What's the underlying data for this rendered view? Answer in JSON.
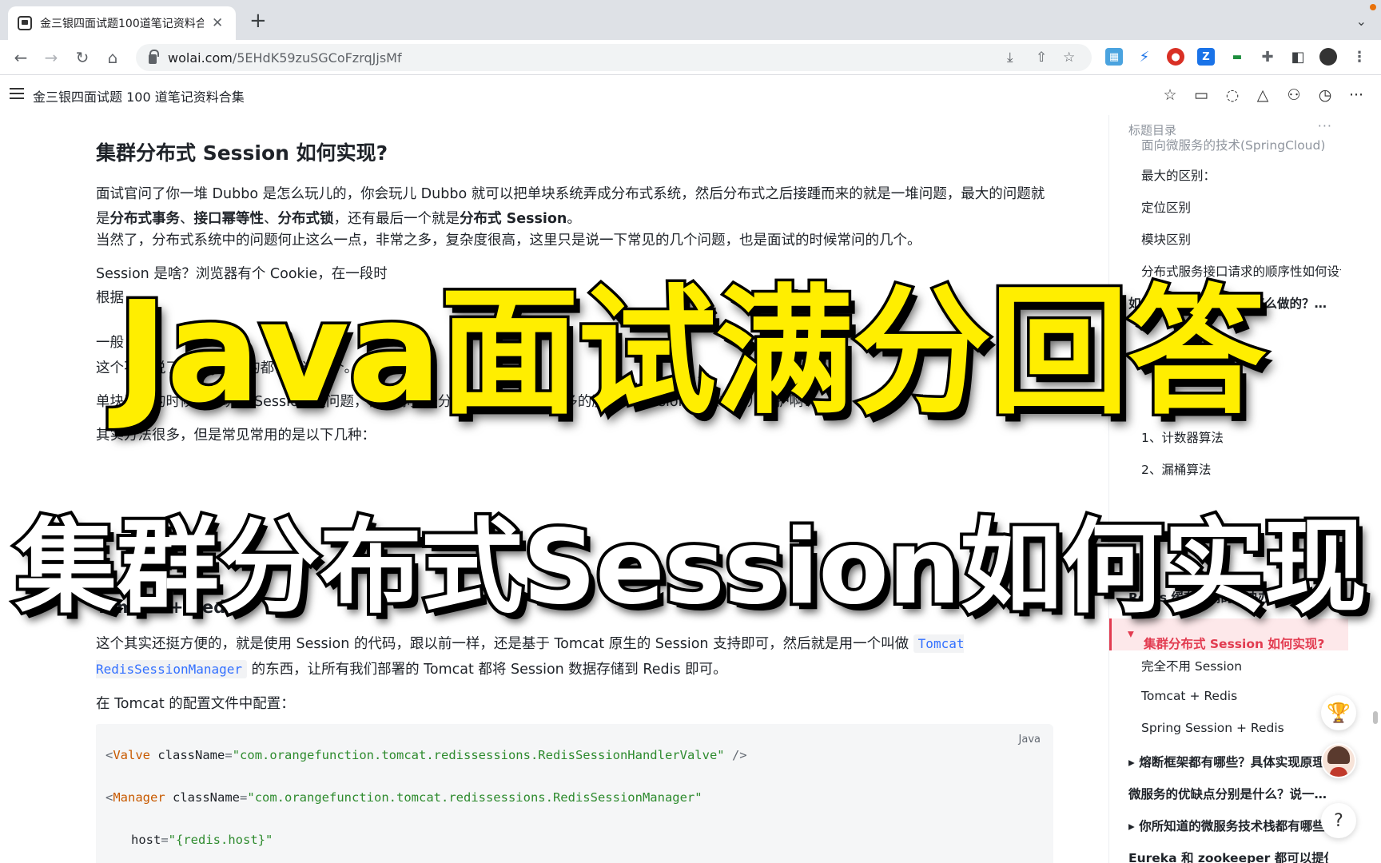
{
  "browser": {
    "tab_title": "金三银四面试题100道笔记资料合",
    "tab_close": "✕",
    "new_tab": "+",
    "url_host": "wolai.com",
    "url_path": "/5EHdK59zuSGCoFzrqJjsMf",
    "icons": [
      "back-icon",
      "forward-icon",
      "reload-icon",
      "home-icon",
      "install-icon",
      "share-icon",
      "bookmark-star-icon"
    ]
  },
  "app": {
    "doc_title": "金三银四面试题 100 道笔记资料合集"
  },
  "content": {
    "heading": "集群分布式 Session 如何实现?",
    "para1_a": "面试官问了你一堆 Dubbo 是怎么玩儿的，你会玩儿 Dubbo 就可以把单块系统弄成分布式系统，然后分布式之后接踵而来的就是一堆问题，最大的问题就是",
    "para1_b1": "分布式事务",
    "para1_sep1": "、",
    "para1_b2": "接口幂等性",
    "para1_sep2": "、",
    "para1_b3": "分布式锁",
    "para1_c": "，还有最后一个就是",
    "para1_b4": "分布式 Session",
    "para1_end": "。",
    "para2": "当然了，分布式系统中的问题何止这么一点，非常之多，复杂度很高，这里只是说一下常见的几个问题，也是面试的时候常问的几个。",
    "para3": "Session 是啥？浏览器有个 Cookie，在一段时",
    "para4": "根据",
    "para5": "一般",
    "para6": "这个不多说了，懂 Java 的都该知道这个。",
    "para7": "单块系统的时候这么玩儿 Session 没问题，但是你要是分布式系统呢，那么多的服务，Session 状态在哪儿维护啊？",
    "para8": "其实方法很多，但是常见常用的是以下几种：",
    "subheading": "Tomcat + Redis",
    "para9_a": "这个其实还挺方便的，就是使用 Session 的代码，跟以前一样，还是基于 Tomcat 原生的 Session 支持即可，然后就是用一个叫做",
    "para9_code": "Tomcat RedisSessionManager",
    "para9_b": "的东西，让所有我们部署的 Tomcat 都将 Session 数据存储到 Redis 即可。",
    "para10": "在 Tomcat 的配置文件中配置：",
    "code_lang": "Java",
    "code": {
      "l1_tag": "Valve",
      "l1_attr": "className",
      "l1_val": "\"com.orangefunction.tomcat.redissessions.RedisSessionHandlerValve\"",
      "l2_tag": "Manager",
      "l2_attr": "className",
      "l2_val": "\"com.orangefunction.tomcat.redissessions.RedisSessionManager\"",
      "l3_attr": "host",
      "l3_val": "\"{redis.host}\""
    }
  },
  "outline": {
    "header": "标题目录",
    "more": "···",
    "items": [
      {
        "label": "面向微服务的技术(SpringCloud)",
        "level": 2
      },
      {
        "label": "最大的区别：",
        "level": 2
      },
      {
        "label": "定位区别",
        "level": 2
      },
      {
        "label": "模块区别",
        "level": 2
      },
      {
        "label": "分布式服务接口请求的顺序性如何设计…",
        "level": 2
      },
      {
        "label": "如何限流？在工作中是怎么做的？…",
        "level": 1
      },
      {
        "label": "1、计数器算法",
        "level": 2
      },
      {
        "label": "2、漏桶算法",
        "level": 2
      },
      {
        "label": "Redis 缓存雪崩的解决办法？",
        "level": 1
      },
      {
        "label": "集群分布式 Session 如何实现?",
        "level": 1,
        "active": true
      },
      {
        "label": "完全不用 Session",
        "level": 2
      },
      {
        "label": "Tomcat + Redis",
        "level": 2
      },
      {
        "label": "Spring Session + Redis",
        "level": 2
      },
      {
        "label": "熔断框架都有哪些？具体实现原理",
        "level": 1
      },
      {
        "label": "微服务的优缺点分别是什么？说一…",
        "level": 1
      },
      {
        "label": "你所知道的微服务技术栈都有哪些",
        "level": 1
      },
      {
        "label": "Eureka 和 zookeeper 都可以提供…",
        "level": 1
      }
    ]
  },
  "overlay": {
    "line1": "Java面试满分回答",
    "line2": "集群分布式Session如何实现"
  },
  "help_label": "?"
}
